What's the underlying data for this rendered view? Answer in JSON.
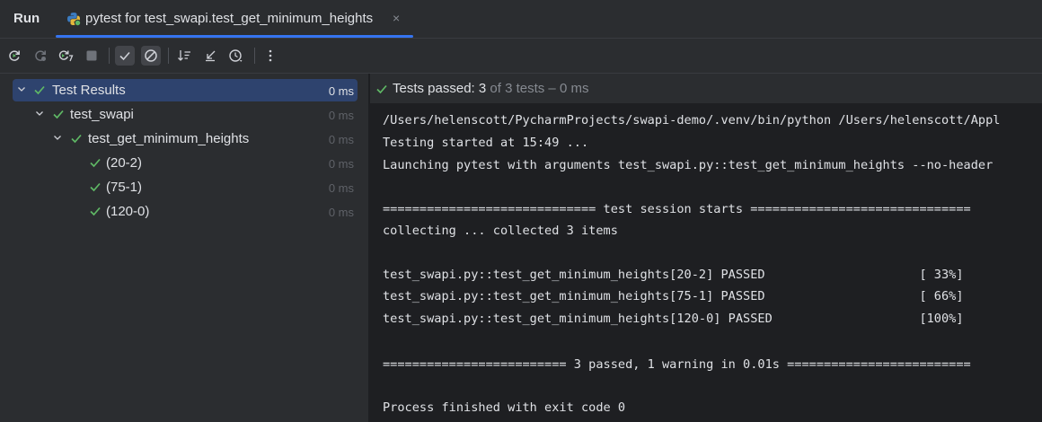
{
  "titlebar": {
    "run_label": "Run",
    "tab_title": "pytest for test_swapi.test_get_minimum_heights",
    "tab_close": "×"
  },
  "toolbar": {
    "icons": [
      "rerun-icon",
      "rerun-failed-icon",
      "toggle-auto-test-icon",
      "stop-icon",
      "show-passed-icon",
      "show-ignored-icon",
      "sort-icon",
      "collapse-icon",
      "history-icon",
      "more-icon"
    ]
  },
  "tree": {
    "rows": [
      {
        "label": "Test Results",
        "time": "0 ms"
      },
      {
        "label": "test_swapi",
        "time": "0 ms"
      },
      {
        "label": "test_get_minimum_heights",
        "time": "0 ms"
      },
      {
        "label": "(20-2)",
        "time": "0 ms"
      },
      {
        "label": "(75-1)",
        "time": "0 ms"
      },
      {
        "label": "(120-0)",
        "time": "0 ms"
      }
    ]
  },
  "status": {
    "strong": "Tests passed: 3",
    "muted": " of 3 tests – 0 ms"
  },
  "console": {
    "lines": [
      "/Users/helenscott/PycharmProjects/swapi-demo/.venv/bin/python /Users/helenscott/Appl",
      "Testing started at 15:49 ...",
      "Launching pytest with arguments test_swapi.py::test_get_minimum_heights --no-header",
      "============================= test session starts ==============================",
      "collecting ... collected 3 items",
      "test_swapi.py::test_get_minimum_heights[20-2] PASSED                     [ 33%]",
      "test_swapi.py::test_get_minimum_heights[75-1] PASSED                     [ 66%]",
      "test_swapi.py::test_get_minimum_heights[120-0] PASSED                    [100%]",
      "========================= 3 passed, 1 warning in 0.01s =========================",
      "Process finished with exit code 0"
    ]
  },
  "colors": {
    "accent": "#3574f0",
    "pass_green": "#5fb865",
    "panel_bg": "#2b2d30",
    "console_bg": "#1e1f22",
    "selection": "#2e436e"
  }
}
